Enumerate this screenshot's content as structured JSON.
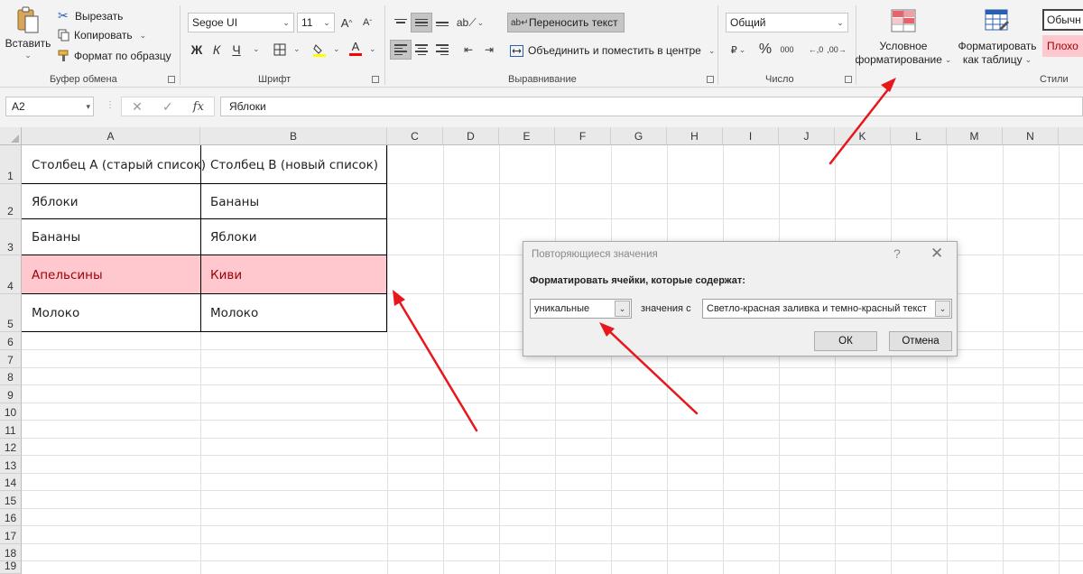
{
  "ribbon": {
    "clipboard": {
      "paste_label": "Вставить",
      "cut_label": "Вырезать",
      "copy_label": "Копировать",
      "format_painter_label": "Формат по образцу",
      "group_label": "Буфер обмена"
    },
    "font": {
      "font_name": "Segoe UI",
      "font_size": "11",
      "bold": "Ж",
      "italic": "К",
      "underline": "Ч",
      "font_color_glyph": "A",
      "group_label": "Шрифт"
    },
    "alignment": {
      "wrap_text_label": "Переносить текст",
      "merge_center_label": "Объединить и поместить в центре",
      "group_label": "Выравнивание"
    },
    "number": {
      "format": "Общий",
      "percent": "%",
      "thousands": "000",
      "group_label": "Число"
    },
    "styles": {
      "conditional_label_1": "Условное",
      "conditional_label_2": "форматирование",
      "table_label_1": "Форматировать",
      "table_label_2": "как таблицу",
      "normal_style": "Обычн",
      "bad_style": "Плохо",
      "group_label": "Стили"
    }
  },
  "formula_bar": {
    "cell_ref": "A2",
    "fx": "fx",
    "value": "Яблоки"
  },
  "columns": [
    "A",
    "B",
    "C",
    "D",
    "E",
    "F",
    "G",
    "H",
    "I",
    "J",
    "K",
    "L",
    "M",
    "N"
  ],
  "rows": [
    "1",
    "2",
    "3",
    "4",
    "5",
    "6",
    "7",
    "8",
    "9",
    "10",
    "11",
    "12",
    "13",
    "14",
    "15",
    "16",
    "17",
    "18",
    "19"
  ],
  "cells": {
    "a1": "Столбец А (старый список)",
    "b1": "Столбец В (новый список)",
    "a2": "Яблоки",
    "b2": "Бананы",
    "a3": "Бананы",
    "b3": "Яблоки",
    "a4": "Апельсины",
    "b4": "Киви",
    "a5": "Молоко",
    "b5": "Молоко"
  },
  "colors": {
    "highlight_fill": "#ffc7ce",
    "highlight_text": "#9c0006",
    "annotation_arrow": "#e8171c"
  },
  "dialog": {
    "title": "Повторяющиеся значения",
    "help": "?",
    "close": "✕",
    "caption": "Форматировать ячейки, которые содержат:",
    "type_value": "уникальные",
    "middle_text": "значения с",
    "format_value": "Светло-красная заливка и темно-красный текст",
    "ok_label": "ОК",
    "cancel_label": "Отмена"
  }
}
